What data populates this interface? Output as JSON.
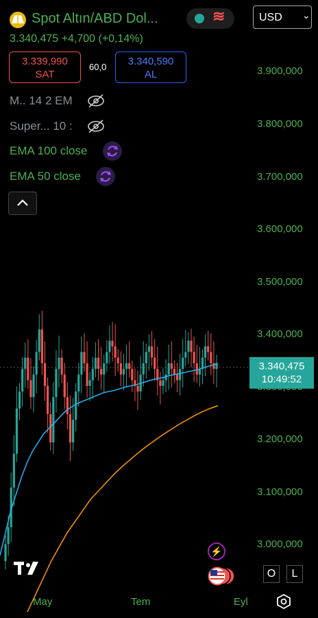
{
  "header": {
    "title": "Spot Altın/ABD Dol...",
    "quote": "3.340,475 +4,700 (+0,14%)",
    "currency": "USD",
    "sell_price": "3.339,990",
    "sell_label": "SAT",
    "buy_price": "3.340,590",
    "buy_label": "AL",
    "spread": "60,0"
  },
  "indicators": [
    {
      "label": "M.. 14 2 EM",
      "icon": "eye-slash-icon",
      "state": "hidden"
    },
    {
      "label": "Super... 10 :",
      "icon": "eye-slash-icon",
      "state": "hidden"
    },
    {
      "label": "EMA 100 close",
      "icon": "refresh-icon",
      "state": "loading"
    },
    {
      "label": "EMA 50 close",
      "icon": "refresh-icon",
      "state": "loading"
    }
  ],
  "y_axis": [
    "3.900,000",
    "3.800,000",
    "3.700,000",
    "3.600,000",
    "3.500,000",
    "3.400,000",
    "3.300,000",
    "3.200,000",
    "3.100,000",
    "3.000,000"
  ],
  "price_tag": {
    "price": "3.340,475",
    "time": "10:49:52"
  },
  "x_axis": [
    "May",
    "Tem",
    "Eyl"
  ],
  "buttons": {
    "log": "O",
    "lock": "L"
  },
  "colors": {
    "up": "#26a69a",
    "down": "#ef5350",
    "ema50": "#29b6f6",
    "ema100": "#ff9800",
    "accent_green": "#4caf50"
  },
  "chart_data": {
    "type": "candlestick",
    "ylim": [
      2950,
      3950
    ],
    "closes": [
      3020,
      3050,
      3120,
      3180,
      3260,
      3290,
      3330,
      3350,
      3310,
      3280,
      3320,
      3360,
      3400,
      3340,
      3300,
      3250,
      3200,
      3280,
      3330,
      3350,
      3320,
      3280,
      3250,
      3200,
      3240,
      3290,
      3320,
      3360,
      3340,
      3300,
      3310,
      3330,
      3350,
      3330,
      3320,
      3340,
      3360,
      3380,
      3370,
      3350,
      3340,
      3320,
      3330,
      3340,
      3330,
      3310,
      3300,
      3290,
      3320,
      3340,
      3360,
      3370,
      3350,
      3330,
      3310,
      3300,
      3310,
      3320,
      3340,
      3330,
      3320,
      3310,
      3330,
      3350,
      3360,
      3380,
      3360,
      3340,
      3320,
      3330,
      3350,
      3370,
      3360,
      3340,
      3330,
      3340
    ],
    "ema50": [
      3000,
      3040,
      3080,
      3110,
      3140,
      3165,
      3185,
      3200,
      3215,
      3225,
      3235,
      3245,
      3255,
      3262,
      3268,
      3272,
      3276,
      3280,
      3284,
      3288,
      3290,
      3292,
      3295,
      3298,
      3300,
      3302,
      3305,
      3308,
      3311,
      3313,
      3315,
      3318,
      3320,
      3322,
      3324,
      3326,
      3328,
      3331,
      3334,
      3337,
      3340
    ],
    "ema100": [
      2900,
      2930,
      2960,
      2990,
      3015,
      3040,
      3060,
      3080,
      3100,
      3115,
      3130,
      3145,
      3158,
      3170,
      3182,
      3193,
      3203,
      3213,
      3222,
      3231,
      3239,
      3247,
      3254,
      3260,
      3265
    ]
  }
}
